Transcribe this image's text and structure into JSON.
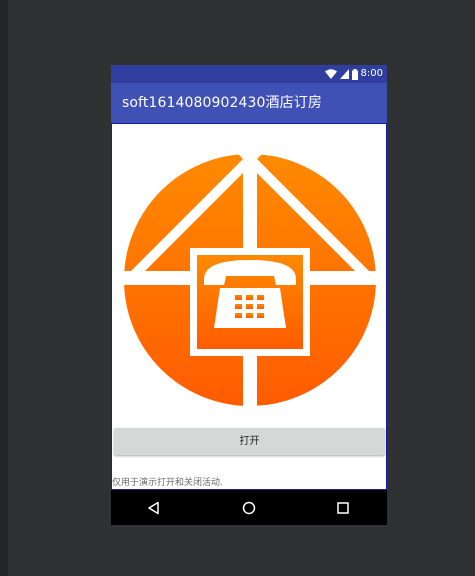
{
  "status_bar": {
    "time": "8:00",
    "icons": [
      "wifi-icon",
      "cell-signal-icon",
      "battery-icon"
    ]
  },
  "app_bar": {
    "title": "soft1614080902430酒店订房"
  },
  "main": {
    "logo_icon": "phone-house-logo",
    "open_button_label": "打开",
    "caption": "仅用于演示打开和关闭活动."
  },
  "nav_bar": {
    "icons": [
      "back-icon",
      "home-icon",
      "recents-icon"
    ]
  },
  "colors": {
    "status_bar": "#303f9f",
    "app_bar": "#3f51b5",
    "logo_top": "#ff8c00",
    "logo_bottom": "#ff5a00",
    "background": "#2f3133"
  }
}
